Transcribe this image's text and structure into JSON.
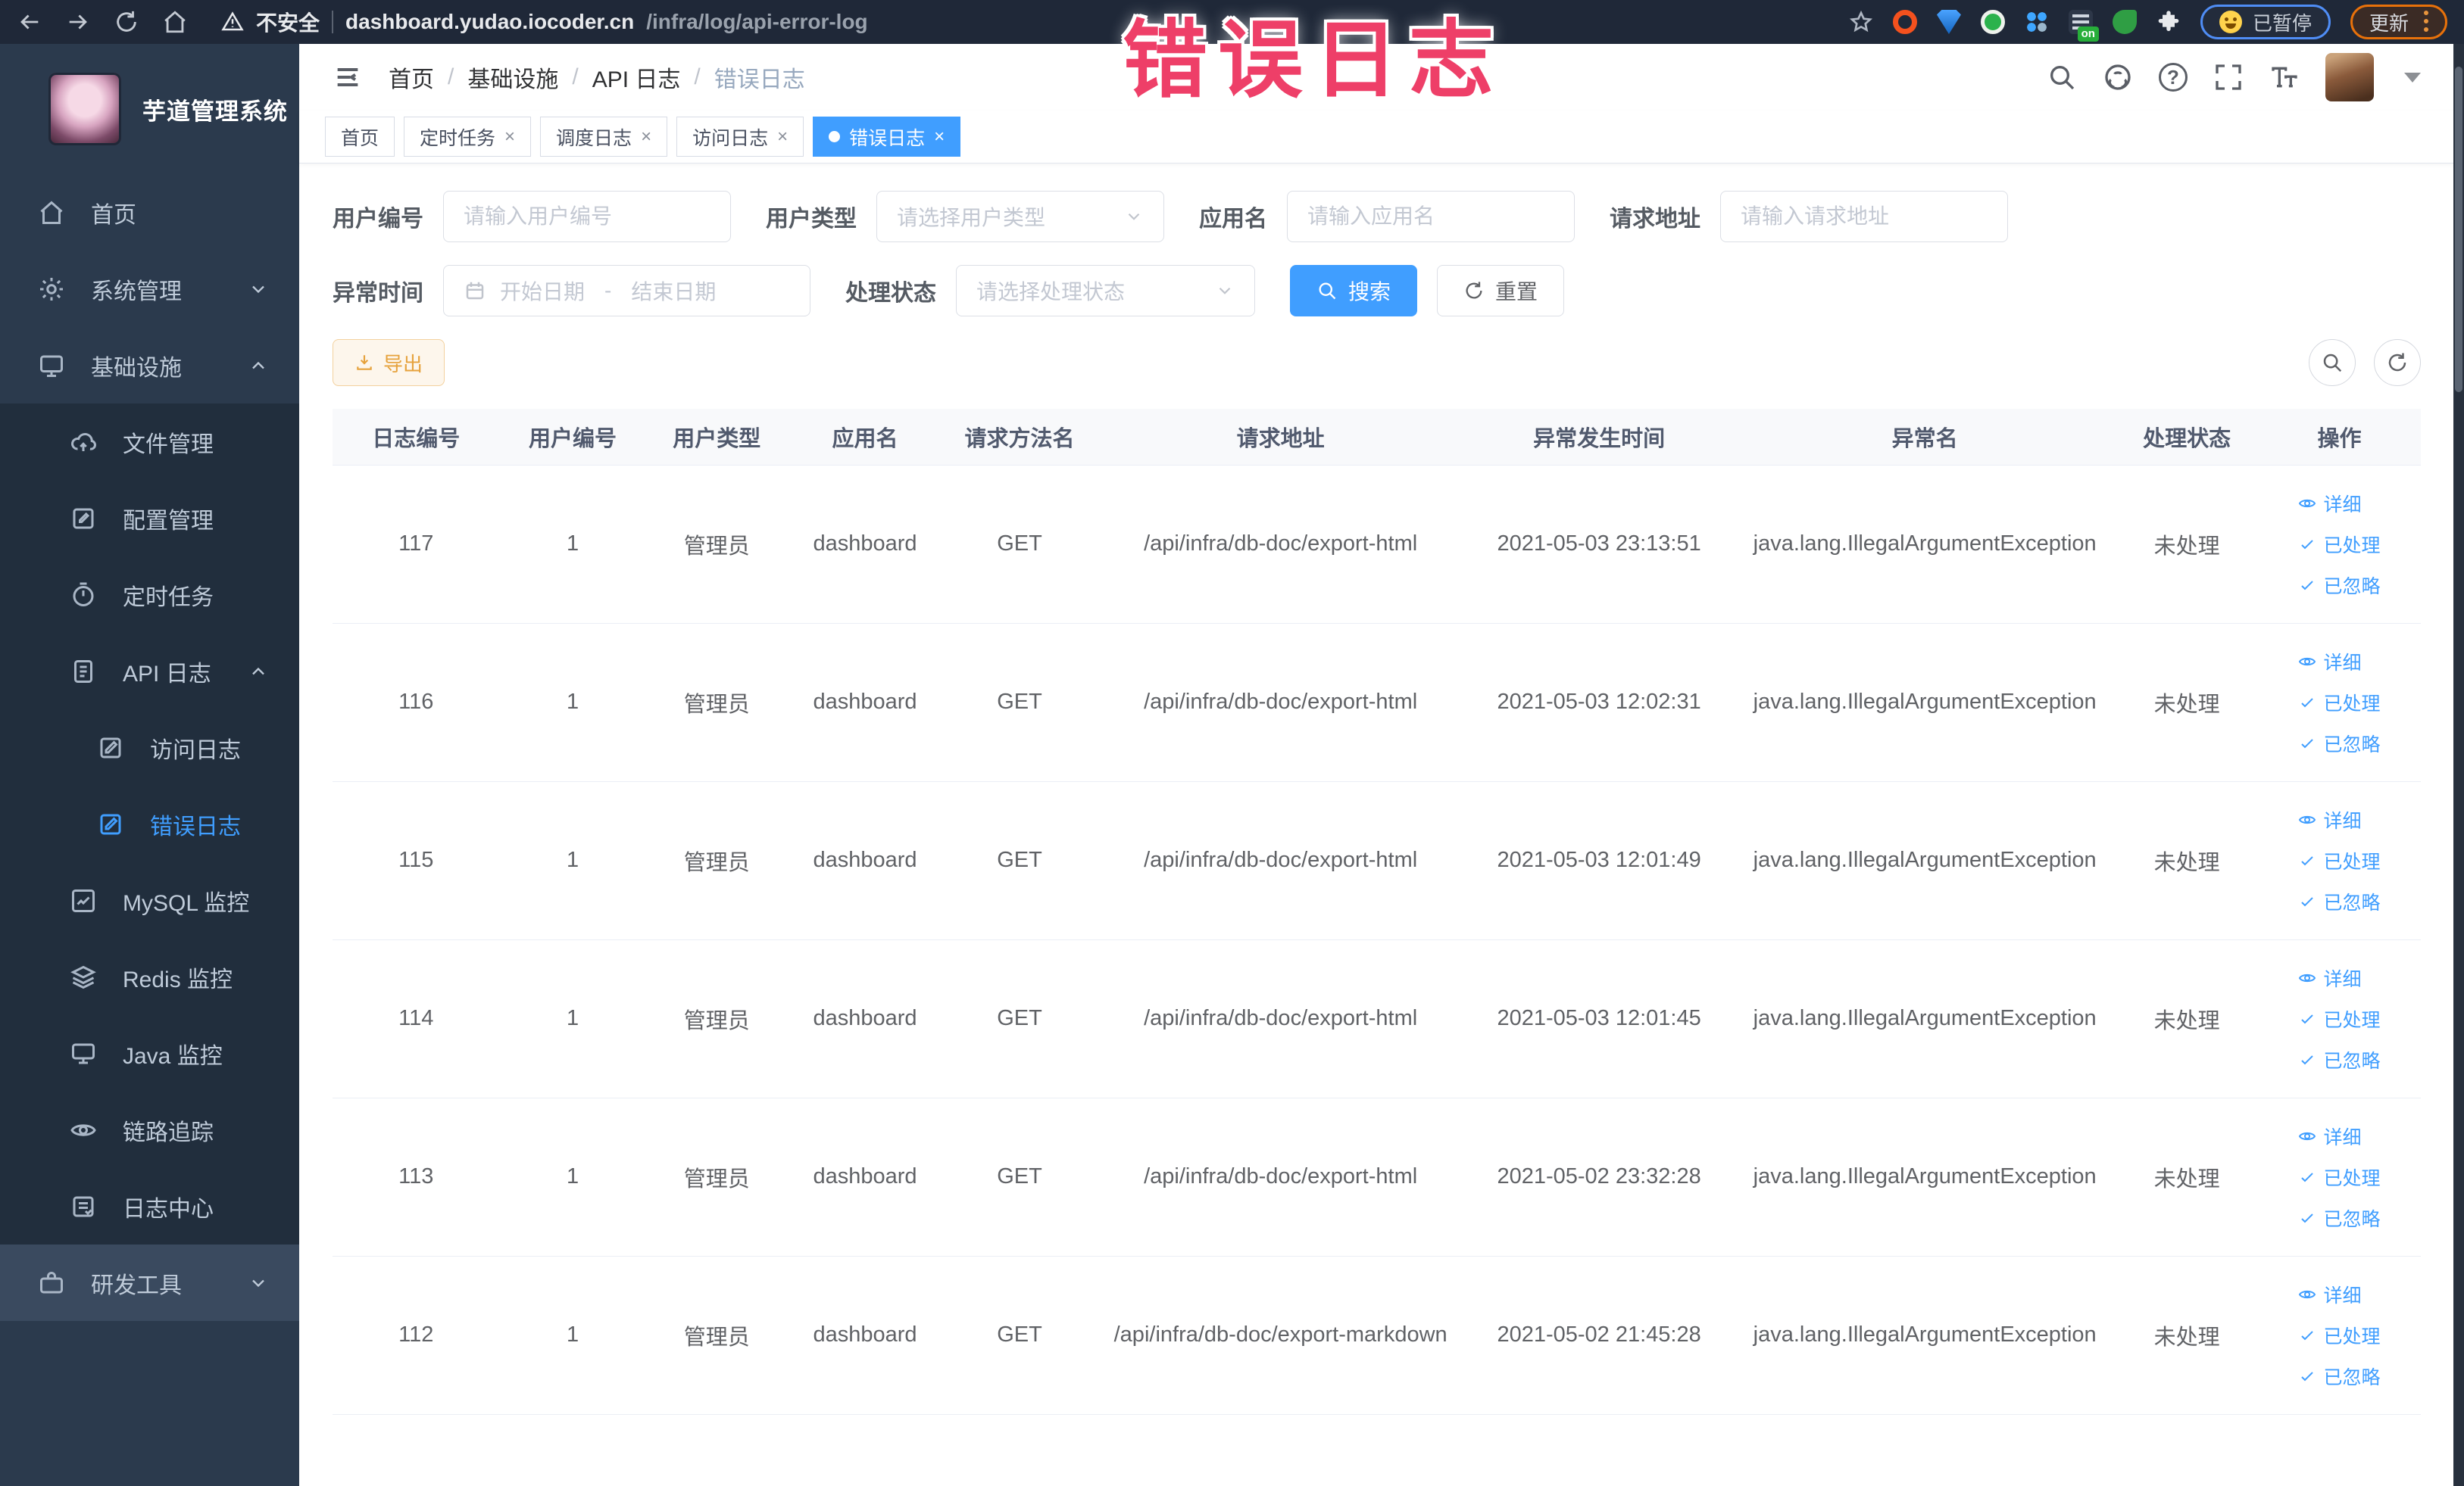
{
  "browser": {
    "security_label": "不安全",
    "url_domain": "dashboard.yudao.iocoder.cn",
    "url_path": "/infra/log/api-error-log",
    "paused_badge": "已暂停",
    "update_badge": "更新",
    "extension_on_badge": "on"
  },
  "annotation": {
    "text": "错误日志",
    "color": "#ee3f68"
  },
  "sidebar": {
    "title": "芋道管理系统",
    "items": [
      {
        "label": "首页"
      },
      {
        "label": "系统管理"
      },
      {
        "label": "基础设施"
      },
      {
        "label": "文件管理"
      },
      {
        "label": "配置管理"
      },
      {
        "label": "定时任务"
      },
      {
        "label": "API 日志"
      },
      {
        "label": "访问日志"
      },
      {
        "label": "错误日志"
      },
      {
        "label": "MySQL 监控"
      },
      {
        "label": "Redis 监控"
      },
      {
        "label": "Java 监控"
      },
      {
        "label": "链路追踪"
      },
      {
        "label": "日志中心"
      },
      {
        "label": "研发工具"
      }
    ]
  },
  "header": {
    "breadcrumb": [
      "首页",
      "基础设施",
      "API 日志",
      "错误日志"
    ]
  },
  "tabs": [
    {
      "label": "首页"
    },
    {
      "label": "定时任务"
    },
    {
      "label": "调度日志"
    },
    {
      "label": "访问日志"
    },
    {
      "label": "错误日志"
    }
  ],
  "filters": {
    "user_id": {
      "label": "用户编号",
      "placeholder": "请输入用户编号"
    },
    "user_type": {
      "label": "用户类型",
      "placeholder": "请选择用户类型"
    },
    "app_name": {
      "label": "应用名",
      "placeholder": "请输入应用名"
    },
    "request_url": {
      "label": "请求地址",
      "placeholder": "请输入请求地址"
    },
    "exception_time": {
      "label": "异常时间",
      "start_placeholder": "开始日期",
      "separator": "-",
      "end_placeholder": "结束日期"
    },
    "process_status": {
      "label": "处理状态",
      "placeholder": "请选择处理状态"
    },
    "search_label": "搜索",
    "reset_label": "重置"
  },
  "toolbar": {
    "export_label": "导出"
  },
  "table": {
    "columns": [
      "日志编号",
      "用户编号",
      "用户类型",
      "应用名",
      "请求方法名",
      "请求地址",
      "异常发生时间",
      "异常名",
      "处理状态",
      "操作"
    ],
    "action_labels": {
      "detail": "详细",
      "processed": "已处理",
      "ignored": "已忽略"
    },
    "rows": [
      {
        "id": "117",
        "user_id": "1",
        "user_type": "管理员",
        "app": "dashboard",
        "method": "GET",
        "url": "/api/infra/db-doc/export-html",
        "time": "2021-05-03 23:13:51",
        "exception": "java.lang.IllegalArgumentException",
        "status": "未处理"
      },
      {
        "id": "116",
        "user_id": "1",
        "user_type": "管理员",
        "app": "dashboard",
        "method": "GET",
        "url": "/api/infra/db-doc/export-html",
        "time": "2021-05-03 12:02:31",
        "exception": "java.lang.IllegalArgumentException",
        "status": "未处理"
      },
      {
        "id": "115",
        "user_id": "1",
        "user_type": "管理员",
        "app": "dashboard",
        "method": "GET",
        "url": "/api/infra/db-doc/export-html",
        "time": "2021-05-03 12:01:49",
        "exception": "java.lang.IllegalArgumentException",
        "status": "未处理"
      },
      {
        "id": "114",
        "user_id": "1",
        "user_type": "管理员",
        "app": "dashboard",
        "method": "GET",
        "url": "/api/infra/db-doc/export-html",
        "time": "2021-05-03 12:01:45",
        "exception": "java.lang.IllegalArgumentException",
        "status": "未处理"
      },
      {
        "id": "113",
        "user_id": "1",
        "user_type": "管理员",
        "app": "dashboard",
        "method": "GET",
        "url": "/api/infra/db-doc/export-html",
        "time": "2021-05-02 23:32:28",
        "exception": "java.lang.IllegalArgumentException",
        "status": "未处理"
      },
      {
        "id": "112",
        "user_id": "1",
        "user_type": "管理员",
        "app": "dashboard",
        "method": "GET",
        "url": "/api/infra/db-doc/export-markdown",
        "time": "2021-05-02 21:45:28",
        "exception": "java.lang.IllegalArgumentException",
        "status": "未处理"
      }
    ]
  },
  "glyphs": {
    "close": "×",
    "breadcrumb_sep": "/",
    "question": "?"
  },
  "colors": {
    "primary": "#409eff",
    "warning": "#e6a23c",
    "annotation_pink": "#ee3f68",
    "sidebar_bg": "#2b3a4d",
    "browser_bar_bg": "#1f2838"
  }
}
